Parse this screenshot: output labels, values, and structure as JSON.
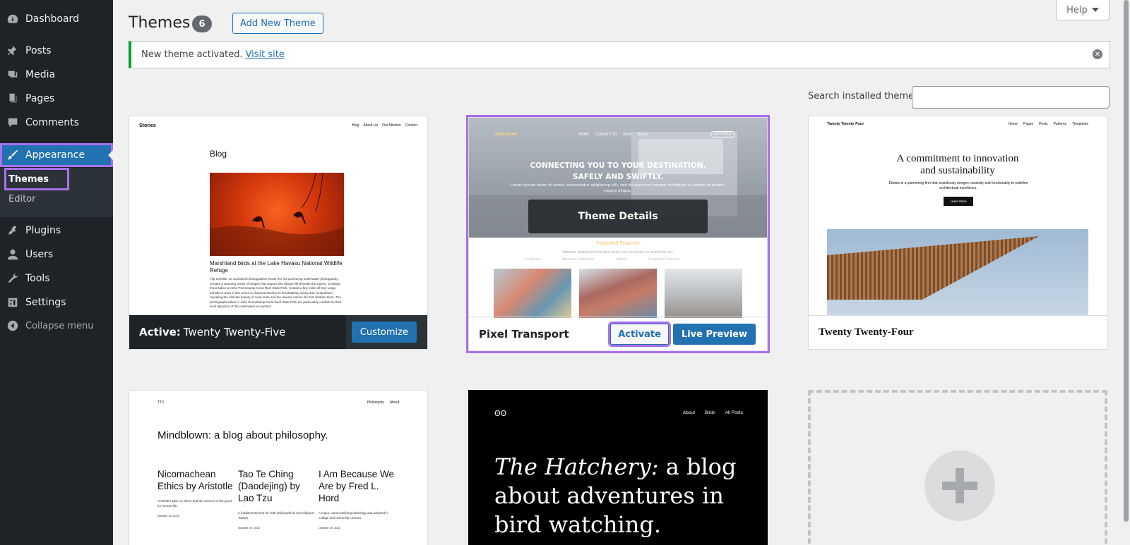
{
  "sidebar": {
    "items": [
      {
        "label": "Dashboard",
        "icon": "dashboard-icon"
      },
      {
        "label": "Posts",
        "icon": "pushpin-icon"
      },
      {
        "label": "Media",
        "icon": "media-icon"
      },
      {
        "label": "Pages",
        "icon": "pages-icon"
      },
      {
        "label": "Comments",
        "icon": "comment-icon"
      },
      {
        "label": "Appearance",
        "icon": "paintbrush-icon"
      },
      {
        "label": "Plugins",
        "icon": "plugin-icon"
      },
      {
        "label": "Users",
        "icon": "user-icon"
      },
      {
        "label": "Tools",
        "icon": "wrench-icon"
      },
      {
        "label": "Settings",
        "icon": "settings-icon"
      }
    ],
    "submenu": {
      "themes": "Themes",
      "editor": "Editor"
    },
    "collapse": "Collapse menu"
  },
  "header": {
    "title": "Themes",
    "count": "6",
    "add_new": "Add New Theme",
    "help": "Help"
  },
  "notice": {
    "text": "New theme activated.",
    "link": "Visit site"
  },
  "search": {
    "label": "Search installed themes",
    "value": ""
  },
  "themes": {
    "active": {
      "prefix": "Active:",
      "name": "Twenty Twenty-Five",
      "customize": "Customize",
      "preview": {
        "site": "Stories",
        "nav": [
          "Blog",
          "About Us",
          "Our Mission",
          "Contact"
        ],
        "heading": "Blog",
        "caption": "Marshland birds at the Lake Havasu National Wildlife Refuge",
        "body": "Flip Schulke, an acclaimed photographer known for his pioneering underwater photography, created a stunning series of images that capture the vibrant life beneath the waves, including those taken at John Pennekamp Coral Reef State Park, located a few miles off Key Largo. Schulke's work in this series is characterized by its breathtaking clarity and composition, revealing the intricate beauty of coral reefs and the diverse marine life that inhabits them. The photographs taken in John Pennekamp Coral Reef State Park are particularly notable for their vivid depiction of the underwater ecosystem."
      }
    },
    "pixel_transport": {
      "name": "Pixel Transport",
      "details": "Theme Details",
      "activate": "Activate",
      "live_preview": "Live Preview",
      "preview": {
        "logo": "Transport",
        "nav": [
          "HOME",
          "CONTACT US",
          "PAGE",
          "BLOG"
        ],
        "cta": "LET'S TALK",
        "heading1": "CONNECTING YOU TO YOUR DESTINATION,",
        "heading2": "SAFELY AND SWIFTLY.",
        "sub": "Lorem ipsum dolor sit amet, consectetur adipiscing elit, sed do eiusmod tempor incididunt ut labore et dolore magna aliqua.",
        "featured": "Featured Projects",
        "feat_sub": "Aenean vestibulum congue erat, nec tincidunt ex molestie vel.",
        "feat_list": [
          "Logistics",
          "Activate Company",
          "Safety",
          "Customer Service"
        ]
      }
    },
    "tt4": {
      "name": "Twenty Twenty-Four",
      "preview": {
        "site": "Twenty Twenty Four",
        "nav": [
          "Home",
          "Pages",
          "Posts",
          "Patterns",
          "Templates"
        ],
        "head1": "A commitment to innovation",
        "head2": "and sustainability",
        "sub": "Études is a pioneering firm that seamlessly merges creativity and functionality to redefine architectural excellence.",
        "learn": "Learn More"
      }
    },
    "tt3": {
      "preview": {
        "site": "TT3",
        "nav": [
          "Philosophy",
          "About"
        ],
        "head": "Mindblown: a blog about philosophy.",
        "posts": [
          {
            "title": "Nicomachean Ethics by Aristotle",
            "desc": "Aristotle's take on ethics and the science of the good for human life.",
            "date": "October 19, 2022"
          },
          {
            "title": "Tao Te Ching (Daodejing) by Lao Tzu",
            "desc": "A fundamental text for both philosophical and religious Taoism.",
            "date": "October 19, 2022"
          },
          {
            "title": "I Am Because We Are by Fred L. Hord",
            "desc": "A major, canon-defining anthology and adopted in college and university courses.",
            "date": "October 19, 2022"
          }
        ]
      }
    },
    "hatchery": {
      "preview": {
        "logo": "ʘʘ",
        "nav": [
          "About",
          "Birds",
          "All Posts"
        ],
        "title_italic": "The Hatchery:",
        "title_rest": "a blog about adventures in bird watching."
      }
    }
  },
  "colors": {
    "sidebar_bg": "#1d2327",
    "accent": "#2271b1",
    "highlight": "#a970f0",
    "notice_success": "#00a32a"
  }
}
